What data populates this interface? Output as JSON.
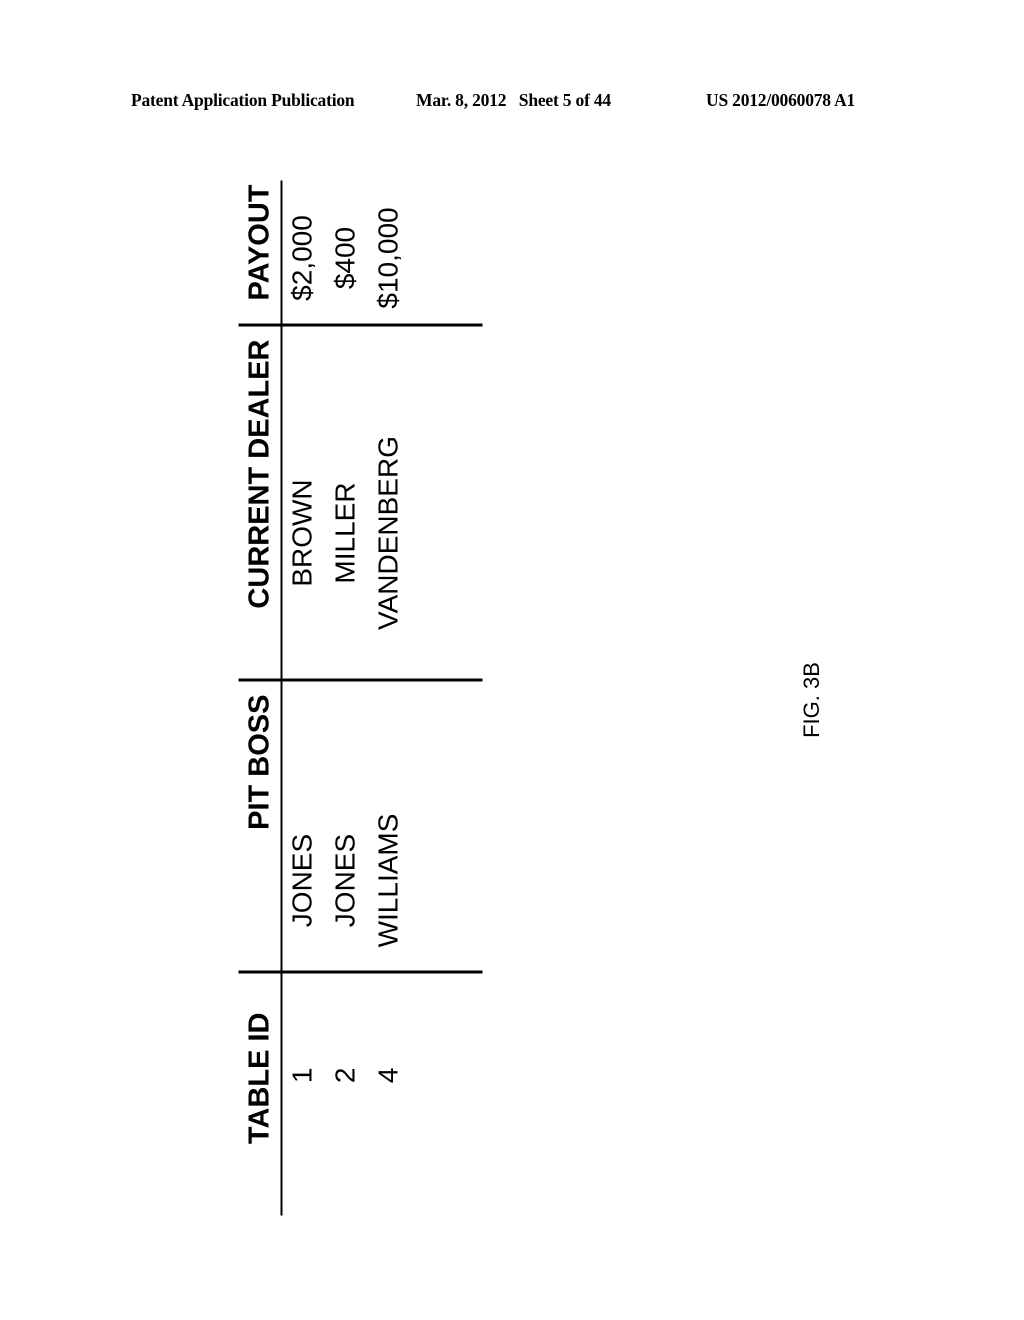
{
  "header": {
    "left": "Patent Application Publication",
    "middle": "Mar. 8, 2012   Sheet 5 of 44",
    "right": "US 2012/0060078 A1"
  },
  "table": {
    "columns": [
      "TABLE ID",
      "PIT BOSS",
      "CURRENT DEALER",
      "PAYOUT"
    ],
    "rows": [
      [
        "1",
        "JONES",
        "BROWN",
        "$2,000"
      ],
      [
        "2",
        "JONES",
        "MILLER",
        "$400"
      ],
      [
        "4",
        "WILLIAMS",
        "VANDENBERG",
        "$10,000"
      ]
    ]
  },
  "figure_label": "FIG. 3B"
}
